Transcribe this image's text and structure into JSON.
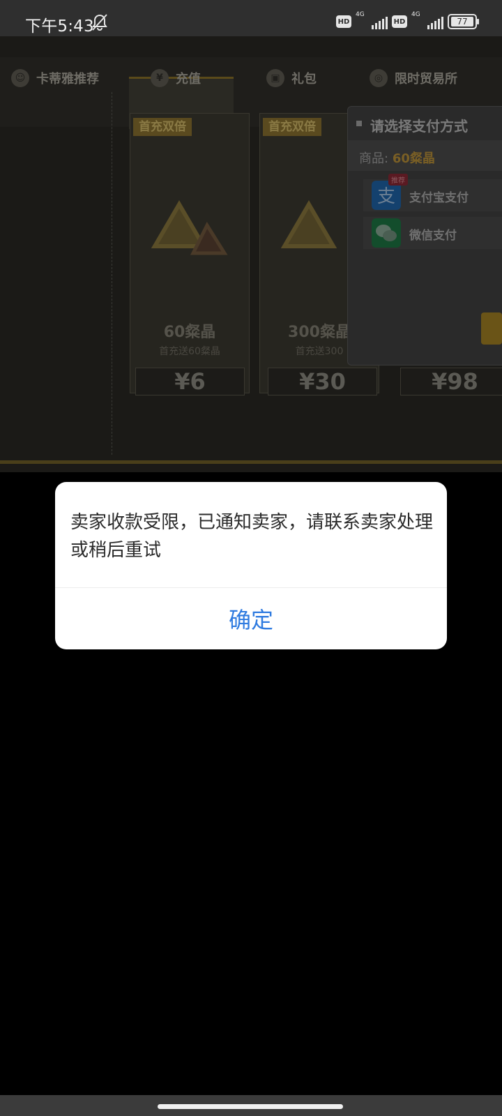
{
  "status_bar": {
    "time": "下午5:43",
    "hd_label": "HD",
    "network_label": "4G",
    "battery_level": "77"
  },
  "game": {
    "tabs": [
      {
        "label": "卡蒂雅推荐",
        "icon": "character-icon"
      },
      {
        "label": "充值",
        "icon": "yen-coin-icon"
      },
      {
        "label": "礼包",
        "icon": "gift-icon"
      },
      {
        "label": "限时贸易所",
        "icon": "trade-icon"
      }
    ],
    "cards": [
      {
        "badge": "首充双倍",
        "amount": "60粲晶",
        "bonus": "首充送60粲晶",
        "price": "¥6"
      },
      {
        "badge": "首充双倍",
        "amount": "300粲晶",
        "bonus": "首充送300",
        "price": "¥30"
      },
      {
        "price": "¥98"
      }
    ],
    "payment_panel": {
      "title": "请选择支付方式",
      "product_label": "商品:",
      "product_value": "60粲晶",
      "options": [
        {
          "label": "支付宝支付",
          "icon": "alipay-icon",
          "tag": "推荐"
        },
        {
          "label": "微信支付",
          "icon": "wechat-pay-icon"
        }
      ]
    }
  },
  "dialog": {
    "message": "卖家收款受限，已通知卖家，请联系卖家处理或稍后重试",
    "confirm_label": "确定"
  },
  "colors": {
    "accent": "#2f7be0",
    "status_bar": "#2f2f2f",
    "alipay": "#1677ff",
    "wechat": "#07c160"
  }
}
